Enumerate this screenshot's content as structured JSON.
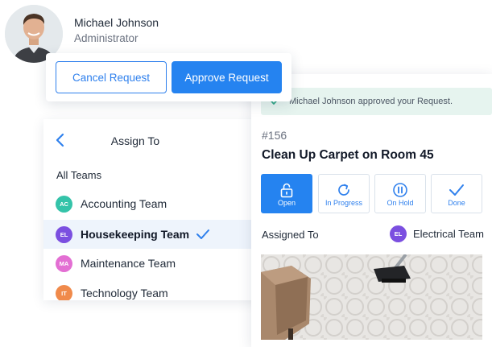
{
  "user": {
    "name": "Michael Johnson",
    "role": "Administrator"
  },
  "actions": {
    "cancel_label": "Cancel Request",
    "approve_label": "Approve Request"
  },
  "assign": {
    "title": "Assign To",
    "section_label": "All Teams",
    "teams": [
      {
        "initials": "AC",
        "name": "Accounting Team",
        "color": "#34c3a9",
        "selected": false
      },
      {
        "initials": "EL",
        "name": "Housekeeping Team",
        "color": "#7b4fe0",
        "selected": true
      },
      {
        "initials": "MA",
        "name": "Maintenance Team",
        "color": "#e36fd3",
        "selected": false
      },
      {
        "initials": "IT",
        "name": "Technology Team",
        "color": "#f08a4b",
        "selected": false
      }
    ]
  },
  "request": {
    "notice": "Michael Johnson approved your Request.",
    "number": "#156",
    "title": "Clean Up Carpet on Room 45",
    "statuses": [
      {
        "label": "Open",
        "icon": "unlock-icon",
        "active": true
      },
      {
        "label": "In Progress",
        "icon": "refresh-icon",
        "active": false
      },
      {
        "label": "On Hold",
        "icon": "pause-icon",
        "active": false
      },
      {
        "label": "Done",
        "icon": "check-icon",
        "active": false
      }
    ],
    "assigned_label": "Assigned To",
    "assigned_team": {
      "initials": "EL",
      "name": "Electrical Team",
      "color": "#7b4fe0"
    }
  },
  "colors": {
    "primary": "#2583f0",
    "notice_bg": "#e6f4ef",
    "selected_row_bg": "#eef4fc"
  }
}
